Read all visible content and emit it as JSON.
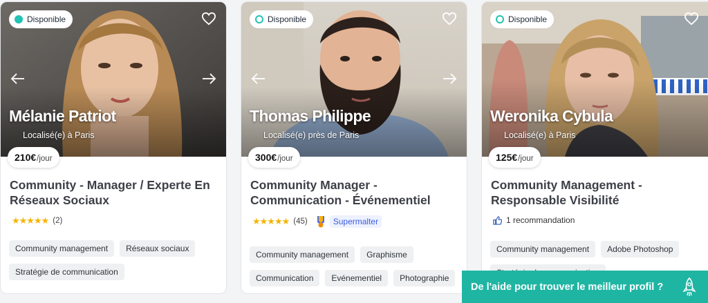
{
  "cards": [
    {
      "availability": "Disponible",
      "name": "Mélanie Patriot",
      "location": "Localisé(e) à Paris",
      "price": "210€",
      "price_unit": "/jour",
      "title": "Community - Manager / Experte En Réseaux Sociaux",
      "stars": "★★★★★",
      "rating_count": "(2)",
      "tags": [
        "Community management",
        "Réseaux sociaux",
        "Stratégie de communication"
      ]
    },
    {
      "availability": "Disponible",
      "name": "Thomas Philippe",
      "location": "Localisé(e) près de Paris",
      "price": "300€",
      "price_unit": "/jour",
      "title": "Community Manager - Communication - Événementiel",
      "stars": "★★★★★",
      "rating_count": "(45)",
      "badge": "Supermalter",
      "tags": [
        "Community management",
        "Graphisme",
        "Communication",
        "Evénementiel",
        "Photographie"
      ]
    },
    {
      "availability": "Disponible",
      "name": "Weronika Cybula",
      "location": "Localisé(e) à Paris",
      "price": "125€",
      "price_unit": "/jour",
      "title": "Community Management - Responsable Visibilité",
      "recommendation": "1 recommandation",
      "tags": [
        "Community management",
        "Adobe Photoshop",
        "Stratégie de communication"
      ]
    }
  ],
  "help_banner": {
    "label": "De l'aide pour trouver le meilleur profil ?",
    "icon": "rocket-icon"
  },
  "icons": [
    "heart-icon",
    "arrow-left-icon",
    "arrow-right-icon",
    "thumbs-up-icon",
    "supermalter-icon",
    "rocket-icon"
  ],
  "colors": {
    "accent": "#1fb5a3",
    "available_dot": "#22c3b3",
    "stars": "#f5b400",
    "supermalter": "#3b5bdb"
  }
}
